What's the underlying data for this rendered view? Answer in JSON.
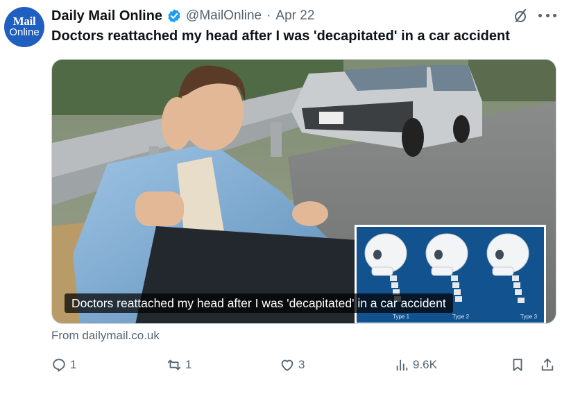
{
  "author": {
    "avatar_line1": "Mail",
    "avatar_line2": "Online",
    "name": "Daily Mail Online",
    "handle": "@MailOnline",
    "separator": "·",
    "date": "Apr 22"
  },
  "tweet": {
    "text": "Doctors reattached my head after I was 'decapitated' in a car accident"
  },
  "card": {
    "caption": "Doctors reattached my head after I was 'decapitated' in a car accident",
    "inset_labels": [
      "Type 1",
      "Type 2",
      "Type 3"
    ],
    "source": "From dailymail.co.uk"
  },
  "actions": {
    "replies": "1",
    "reposts": "1",
    "likes": "3",
    "views": "9.6K"
  },
  "colors": {
    "verified": "#1d9bf0",
    "avatar_bg": "#1f5fbf",
    "muted_text": "#536471"
  }
}
